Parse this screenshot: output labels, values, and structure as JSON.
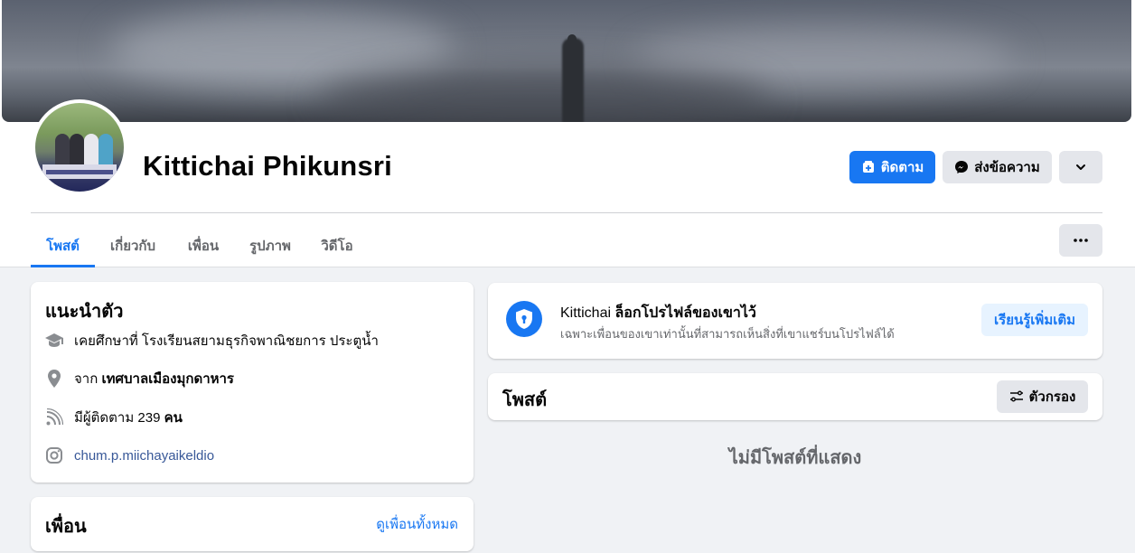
{
  "profile": {
    "name": "Kittichai Phikunsri",
    "follow_label": "ติดตาม",
    "message_label": "ส่งข้อความ"
  },
  "tabs": [
    {
      "label": "โพสต์",
      "active": true
    },
    {
      "label": "เกี่ยวกับ",
      "active": false
    },
    {
      "label": "เพื่อน",
      "active": false
    },
    {
      "label": "รูปภาพ",
      "active": false
    },
    {
      "label": "วิดีโอ",
      "active": false
    }
  ],
  "intro": {
    "title": "แนะนำตัว",
    "education": "เคยศึกษาที่ โรงเรียนสยามธุรกิจพาณิชยการ ประตูน้ำ",
    "from_prefix": "จาก",
    "from_place": "เทศบาลเมืองมุกดาหาร",
    "followers_prefix": "มีผู้ติดตาม",
    "followers_count": "239",
    "followers_suffix": "คน",
    "instagram": "chum.p.miichayaikeldio"
  },
  "friends": {
    "title": "เพื่อน",
    "see_all": "ดูเพื่อนทั้งหมด"
  },
  "locked": {
    "name": "Kittichai",
    "headline": "ล็อกโปรไฟล์ของเขาไว้",
    "description": "เฉพาะเพื่อนของเขาเท่านั้นที่สามารถเห็นสิ่งที่เขาแชร์บนโปรไฟล์ได้",
    "learn_more": "เรียนรู้เพิ่มเติม"
  },
  "posts": {
    "title": "โพสต์",
    "filter_label": "ตัวกรอง",
    "empty_text": "ไม่มีโพสต์ที่แสดง"
  },
  "colors": {
    "accent": "#1877f2",
    "secondary_button": "#e4e6eb",
    "background": "#f0f2f5"
  },
  "icons": {
    "follow": "add-friend-icon",
    "message": "messenger-icon",
    "more": "chevron-down-icon",
    "tab_more": "more-dots-icon",
    "education": "graduation-cap-icon",
    "location": "location-pin-icon",
    "followers": "rss-icon",
    "instagram": "instagram-icon",
    "lock": "shield-lock-icon",
    "filter": "filter-icon"
  }
}
